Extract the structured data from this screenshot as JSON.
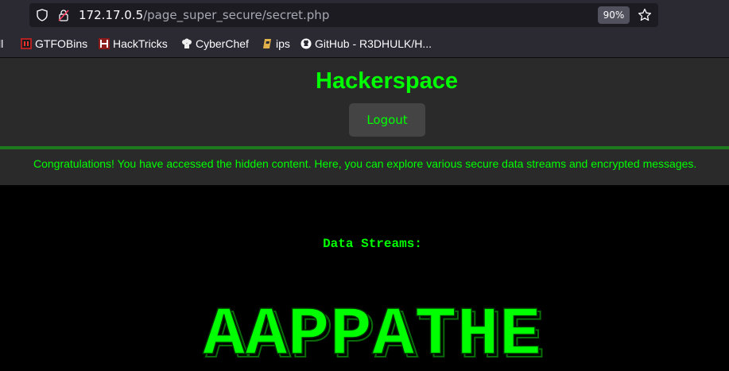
{
  "browser": {
    "url_host": "172.17.0.5",
    "url_path": "/page_super_secure/secret.php",
    "zoom": "90%",
    "bookmarks": [
      {
        "label": "ll",
        "icon": "none"
      },
      {
        "label": "GTFOBins",
        "icon": "gtfobins-icon"
      },
      {
        "label": "HackTricks",
        "icon": "hacktricks-icon"
      },
      {
        "label": "CyberChef",
        "icon": "cyberchef-icon"
      },
      {
        "label": "ips",
        "icon": "ips-icon"
      },
      {
        "label": "GitHub - R3DHULK/H...",
        "icon": "github-icon"
      }
    ]
  },
  "page": {
    "title": "Hackerspace",
    "logout_label": "Logout",
    "message": "Congratulations! You have accessed the hidden content. Here, you can explore various secure data streams and encrypted messages.",
    "streams_heading": "Data Streams:",
    "ascii_text": "AAPPATHE"
  },
  "colors": {
    "accent_green": "#00ff00",
    "panel": "#2a2a2a",
    "button": "#444444",
    "background": "#000000"
  }
}
